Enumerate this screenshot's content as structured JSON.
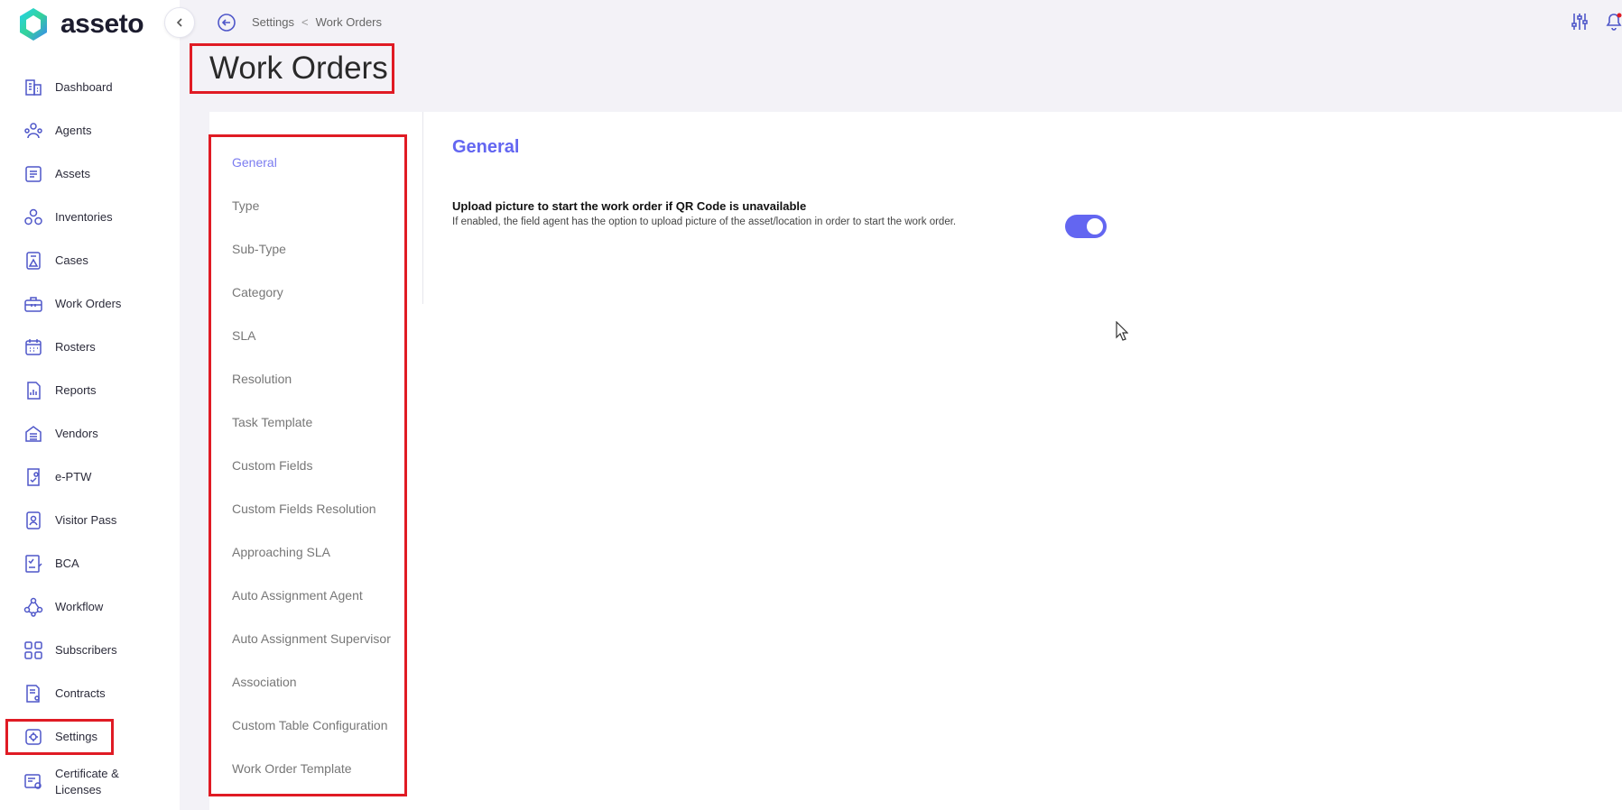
{
  "app": {
    "logo_text": "asseto"
  },
  "colors": {
    "accent": "#6366f1",
    "highlight": "#e01b24",
    "icon": "#4f57c9"
  },
  "sidebar": {
    "items": [
      {
        "label": "Dashboard",
        "icon": "building-icon"
      },
      {
        "label": "Agents",
        "icon": "agents-icon"
      },
      {
        "label": "Assets",
        "icon": "assets-icon"
      },
      {
        "label": "Inventories",
        "icon": "inventories-icon"
      },
      {
        "label": "Cases",
        "icon": "cases-icon"
      },
      {
        "label": "Work Orders",
        "icon": "toolbox-icon"
      },
      {
        "label": "Rosters",
        "icon": "calendar-icon"
      },
      {
        "label": "Reports",
        "icon": "report-icon"
      },
      {
        "label": "Vendors",
        "icon": "vendor-icon"
      },
      {
        "label": "e-PTW",
        "icon": "permit-icon"
      },
      {
        "label": "Visitor Pass",
        "icon": "badge-icon"
      },
      {
        "label": "BCA",
        "icon": "checklist-icon"
      },
      {
        "label": "Workflow",
        "icon": "workflow-icon"
      },
      {
        "label": "Subscribers",
        "icon": "grid-icon"
      },
      {
        "label": "Contracts",
        "icon": "contract-icon"
      },
      {
        "label": "Settings",
        "icon": "settings-icon"
      },
      {
        "label": "Certificate &\nLicenses",
        "label_line1": "Certificate &",
        "label_line2": "Licenses",
        "icon": "certificate-icon"
      }
    ]
  },
  "breadcrumb": {
    "parent": "Settings",
    "separator": "<",
    "current": "Work Orders"
  },
  "page": {
    "title": "Work Orders"
  },
  "settings_nav": {
    "items": [
      {
        "label": "General",
        "active": true
      },
      {
        "label": "Type"
      },
      {
        "label": "Sub-Type"
      },
      {
        "label": "Category"
      },
      {
        "label": "SLA"
      },
      {
        "label": "Resolution"
      },
      {
        "label": "Task Template"
      },
      {
        "label": "Custom Fields"
      },
      {
        "label": "Custom Fields Resolution"
      },
      {
        "label": "Approaching SLA"
      },
      {
        "label": "Auto Assignment Agent"
      },
      {
        "label": "Auto Assignment Supervisor"
      },
      {
        "label": "Association"
      },
      {
        "label": "Custom Table Configuration"
      },
      {
        "label": "Work Order Template"
      }
    ]
  },
  "general": {
    "title": "General",
    "option_title": "Upload picture to start the work order if QR Code is unavailable",
    "option_desc": "If enabled, the field agent has the option to upload picture of the asset/location in order to start the work order.",
    "toggle_on": true
  }
}
